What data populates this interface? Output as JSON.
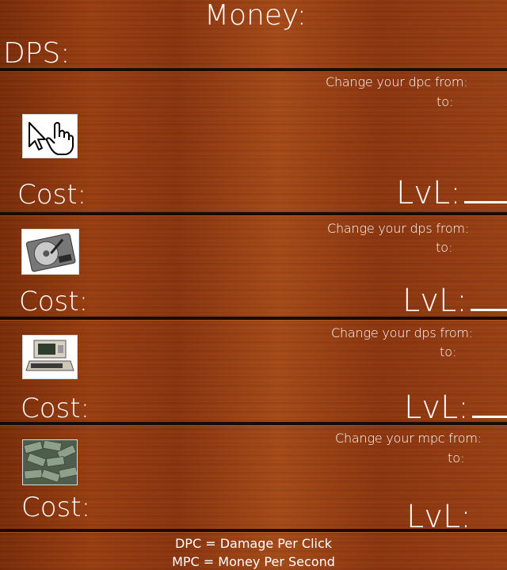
{
  "header": {
    "money_label": "Money:",
    "dps_label": "DPS:"
  },
  "upgrades": [
    {
      "icon": "cursor-hand-icon",
      "change_text": "Change your dpc from:",
      "to_text": "to:",
      "cost_label": "Cost:",
      "level_label": "LvL:"
    },
    {
      "icon": "hard-drive-icon",
      "change_text": "Change your dps from:",
      "to_text": "to:",
      "cost_label": "Cost:",
      "level_label": "LvL:"
    },
    {
      "icon": "retro-computer-icon",
      "change_text": "Change your dps from:",
      "to_text": "to:",
      "cost_label": "Cost:",
      "level_label": "LvL:"
    },
    {
      "icon": "money-pile-icon",
      "change_text": "Change your mpc from:",
      "to_text": "to:",
      "cost_label": "Cost:",
      "level_label": "LvL:"
    }
  ],
  "legend": {
    "dpc": "DPC = Damage Per Click",
    "mpc": "MPC = Money Per Second"
  }
}
